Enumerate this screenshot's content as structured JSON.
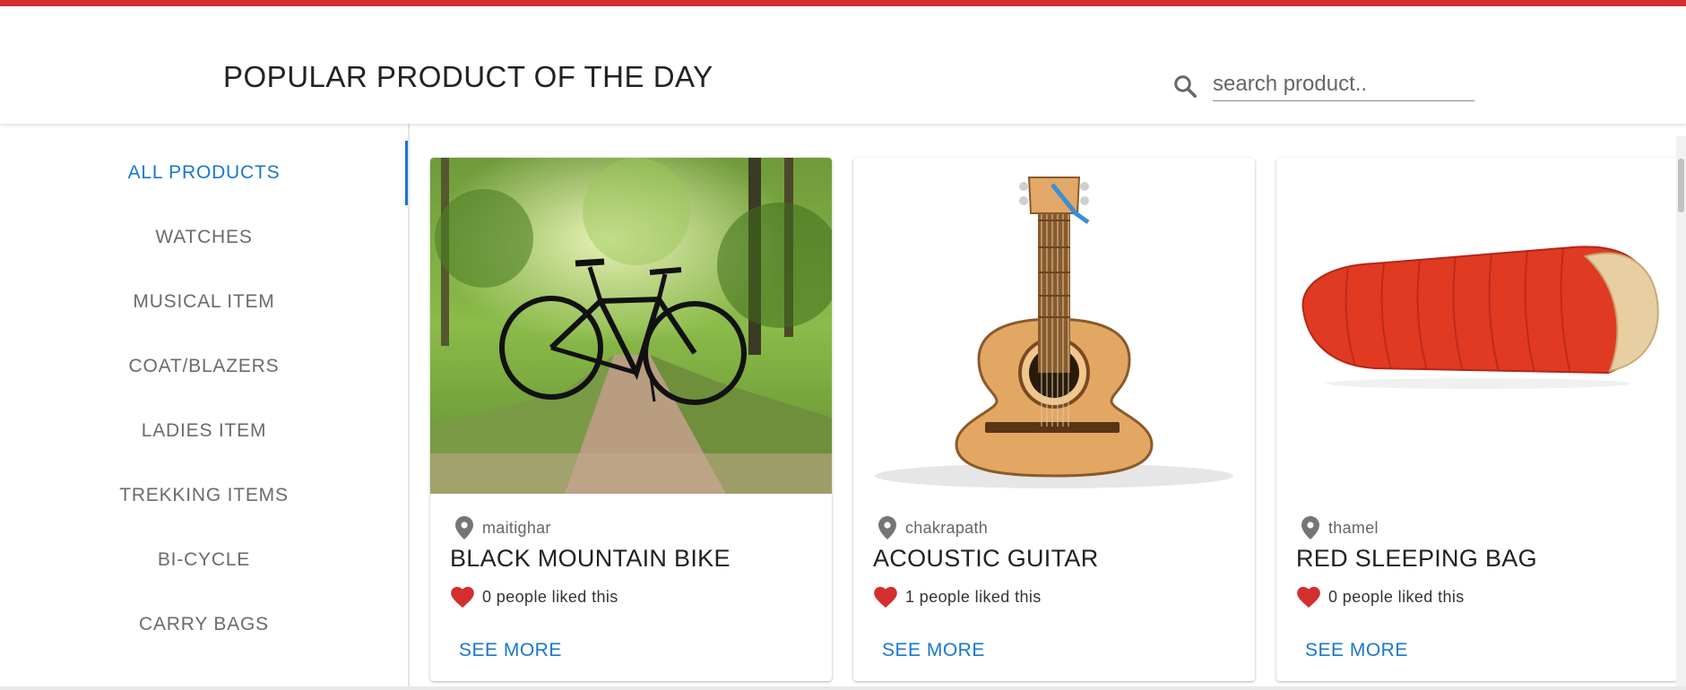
{
  "header": {
    "title": "POPULAR PRODUCT OF THE DAY",
    "search_placeholder": "search product..",
    "search_value": ""
  },
  "sidebar": {
    "active_index": 0,
    "items": [
      {
        "label": "ALL PRODUCTS"
      },
      {
        "label": "WATCHES"
      },
      {
        "label": "MUSICAL ITEM"
      },
      {
        "label": "COAT/BLAZERS"
      },
      {
        "label": "LADIES ITEM"
      },
      {
        "label": "TREKKING ITEMS"
      },
      {
        "label": "BI-CYCLE"
      },
      {
        "label": "CARRY BAGS"
      }
    ]
  },
  "products": [
    {
      "location": "maitighar",
      "title": "BLACK MOUNTAIN BIKE",
      "likes": "0 people liked this",
      "action": "SEE MORE",
      "image": "bicycle-photo"
    },
    {
      "location": "chakrapath",
      "title": "ACOUSTIC GUITAR",
      "likes": "1 people liked this",
      "action": "SEE MORE",
      "image": "guitar-photo"
    },
    {
      "location": "thamel",
      "title": "RED SLEEPING BAG",
      "likes": "0 people liked this",
      "action": "SEE MORE",
      "image": "sleeping-bag-photo"
    }
  ],
  "colors": {
    "accent": "#1976d2",
    "brand_bar": "#d32f2f",
    "heart": "#d32f2f"
  },
  "icons": {
    "search": "search-icon",
    "location": "location-pin-icon",
    "like": "heart-icon"
  }
}
